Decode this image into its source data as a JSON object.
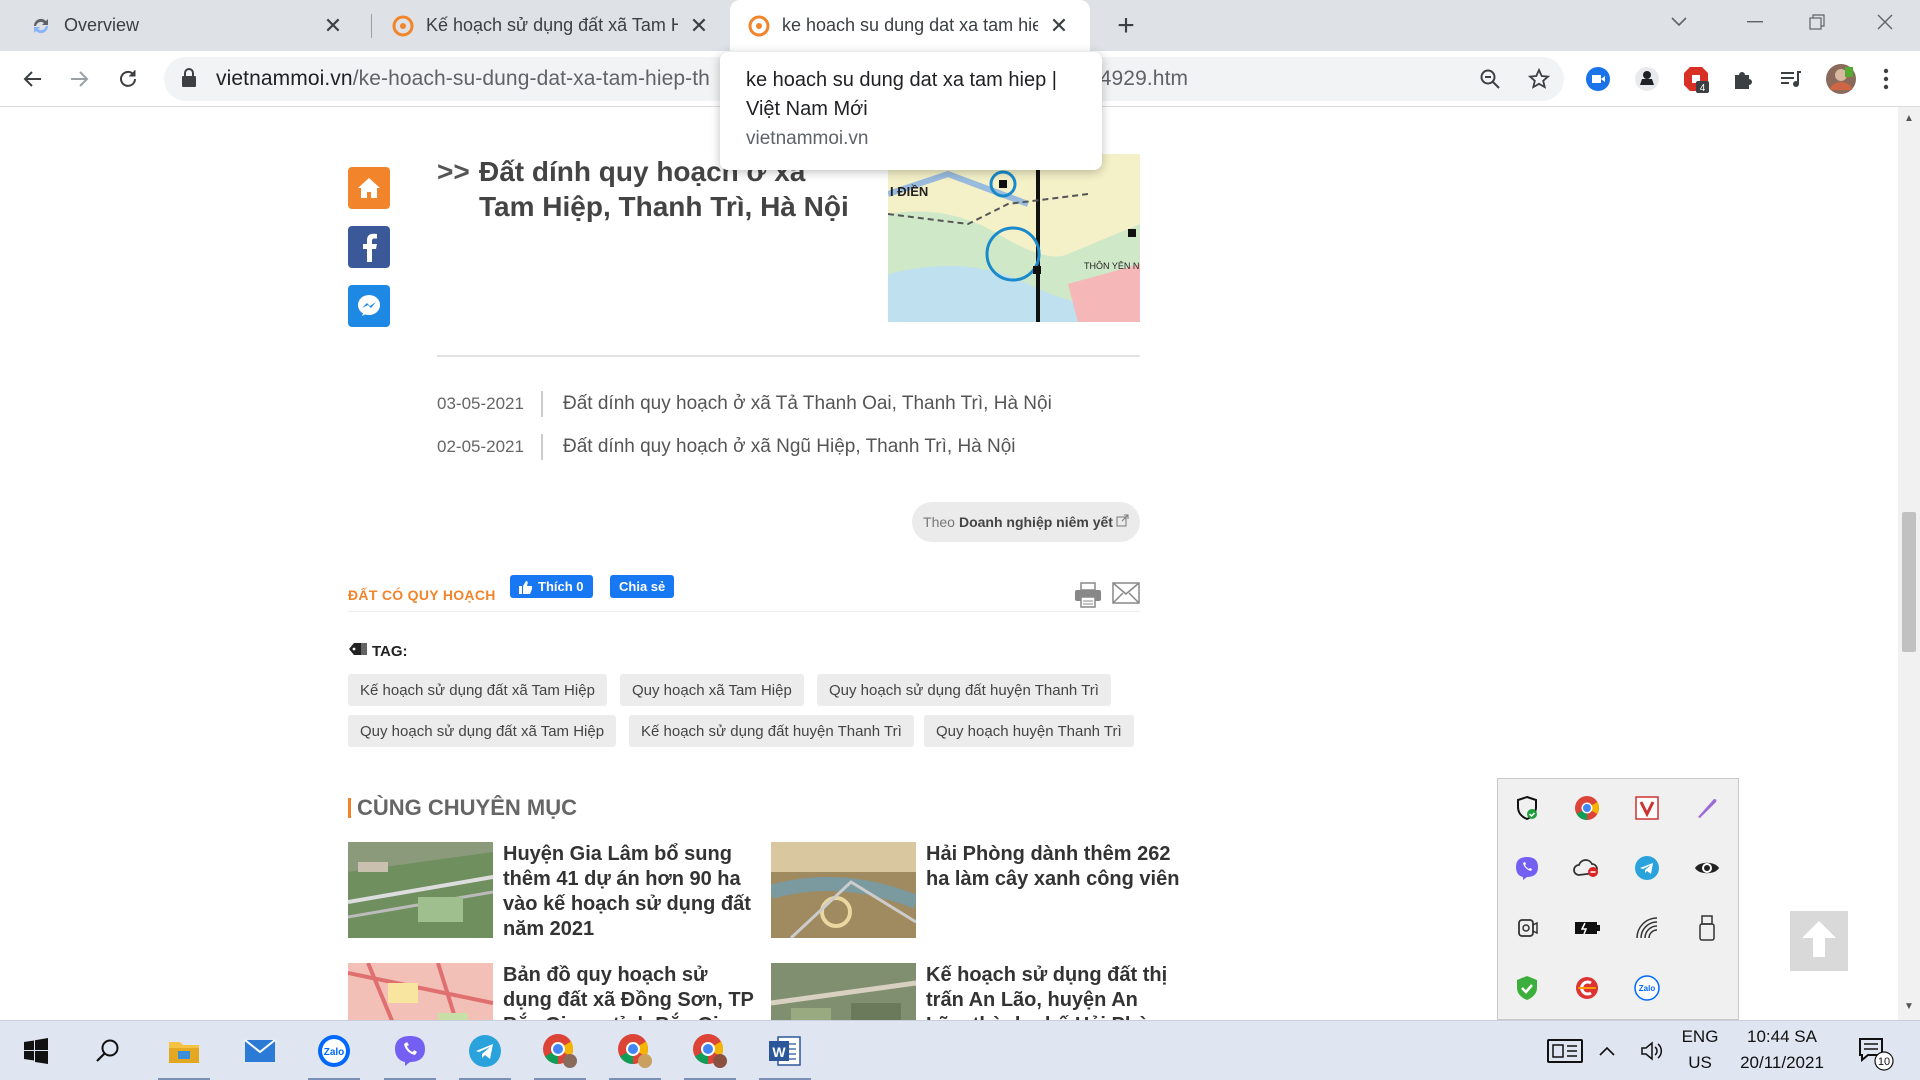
{
  "window": {
    "tabs": [
      {
        "title": "Overview",
        "favicon": "sync-icon",
        "active": false
      },
      {
        "title": "Kế hoạch sử dụng đất xã Tam Hiệp",
        "favicon": "site-logo-icon",
        "active": false
      },
      {
        "title": "ke hoach su dung dat xa tam hiep",
        "favicon": "site-logo-icon",
        "active": true
      }
    ],
    "new_tab_label": "+"
  },
  "toolbar": {
    "url_domain": "vietnammoi.vn",
    "url_path_visible": "/ke-hoach-su-dung-dat-xa-tam-hiep-th",
    "url_tail": "34929.htm",
    "extension_badge": "4"
  },
  "tooltip": {
    "title": "ke hoach su dung dat xa tam hiep | Việt Nam Mới",
    "domain": "vietnammoi.vn"
  },
  "article": {
    "related_featured": {
      "prefix": ">>",
      "title": "Đất dính quy hoạch ở xã Tam Hiệp, Thanh Trì, Hà Nội",
      "map_label_1": "I ĐIỀN",
      "map_label_2": "THÔN YÊN N"
    },
    "related_list": [
      {
        "date": "03-05-2021",
        "title": "Đất dính quy hoạch ở xã Tả Thanh Oai, Thanh Trì, Hà Nội"
      },
      {
        "date": "02-05-2021",
        "title": "Đất dính quy hoạch ở xã Ngũ Hiệp, Thanh Trì, Hà Nội"
      }
    ],
    "source": {
      "prefix": "Theo",
      "name": "Doanh nghiệp niêm yết"
    },
    "category": "ĐẤT CÓ QUY HOẠCH",
    "fb_like": "Thích 0",
    "fb_share": "Chia sẻ",
    "tag_label": "TAG:",
    "tags": [
      "Kế hoạch sử dụng đất xã Tam Hiệp",
      "Quy hoạch xã Tam Hiệp",
      "Quy hoạch sử dụng đất huyện Thanh Trì",
      "Quy hoạch sử dụng đất xã Tam Hiệp",
      "Kế hoạch sử dụng đất huyện Thanh Trì",
      "Quy hoạch huyện Thanh Trì"
    ],
    "section_title": "CÙNG CHUYÊN MỤC",
    "news": [
      {
        "title": "Huyện Gia Lâm bổ sung thêm 41 dự án hơn 90 ha vào kế hoạch sử dụng đất năm 2021"
      },
      {
        "title": "Hải Phòng dành thêm 262 ha làm cây xanh công viên"
      },
      {
        "title": "Bản đồ quy hoạch sử dụng đất xã Đồng Sơn, TP Bắc Giang, tỉnh Bắc Giang"
      },
      {
        "title": "Kế hoạch sử dụng đất thị trấn An Lão, huyện An Lão, thành phố Hải Phòng"
      }
    ]
  },
  "tray_icons": [
    "windows-security-icon",
    "chrome-icon",
    "vivaldi-icon",
    "pen-icon",
    "viber-icon",
    "onedrive-icon",
    "telegram-icon",
    "eye-icon",
    "camera-icon",
    "battery-icon",
    "wifi-icon",
    "usb-icon",
    "check-icon",
    "ccleaner-icon",
    "zalo-icon"
  ],
  "taskbar": {
    "language_1": "ENG",
    "language_2": "US",
    "time": "10:44 SA",
    "date": "20/11/2021",
    "notification_count": "10",
    "zalo_label": "Zalo",
    "word_letter": "W"
  },
  "colors": {
    "accent_orange": "#f2842c",
    "facebook_blue": "#1877f2",
    "tab_bg": "#dee1e6",
    "taskbar_bg": "#dfe6f2"
  }
}
